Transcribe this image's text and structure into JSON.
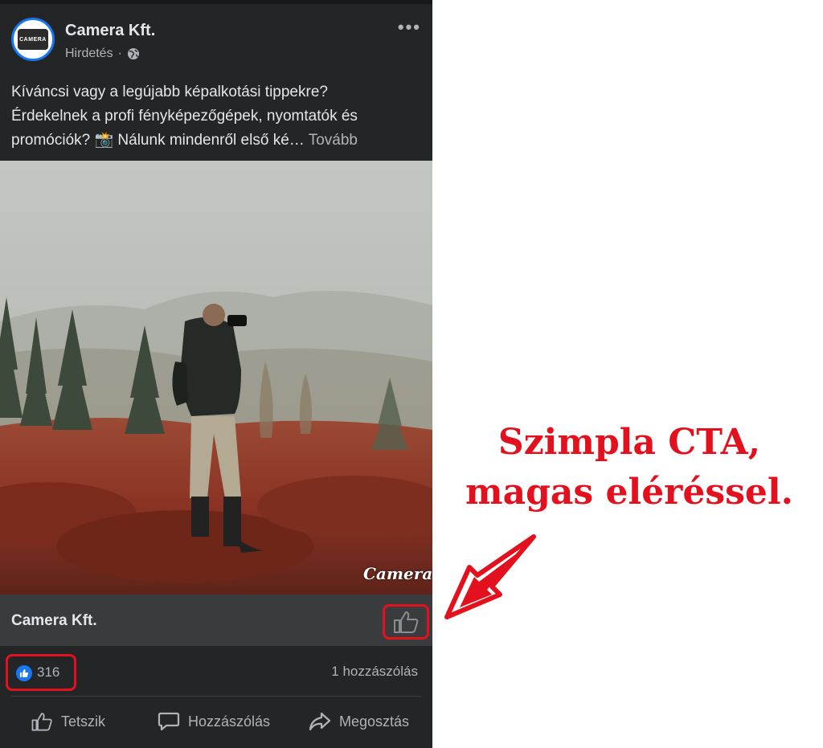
{
  "post": {
    "page_name": "Camera Kft.",
    "sponsored_label": "Hirdetés",
    "separator": "·",
    "more_menu": "•••",
    "caption_line1": "Kíváncsi vagy a legújabb képalkotási tippekre?",
    "caption_line2": "Érdekelnek a profi fényképezőgépek, nyomtatók és",
    "caption_line3": "promóciók? 📸 Nálunk mindenről első ké…",
    "see_more": "Tovább",
    "photo_watermark": "Camera",
    "link_title": "Camera Kft.",
    "likes_count": "316",
    "comments_count": "1 hozzászólás",
    "actions": {
      "like": "Tetszik",
      "comment": "Hozzászólás",
      "share": "Megosztás"
    }
  },
  "annotation": {
    "line1": "Szimpla CTA,",
    "line2": "magas eléréssel."
  },
  "colors": {
    "accent_red": "#e3111d",
    "facebook_blue": "#1877f2",
    "post_background": "#242526"
  }
}
